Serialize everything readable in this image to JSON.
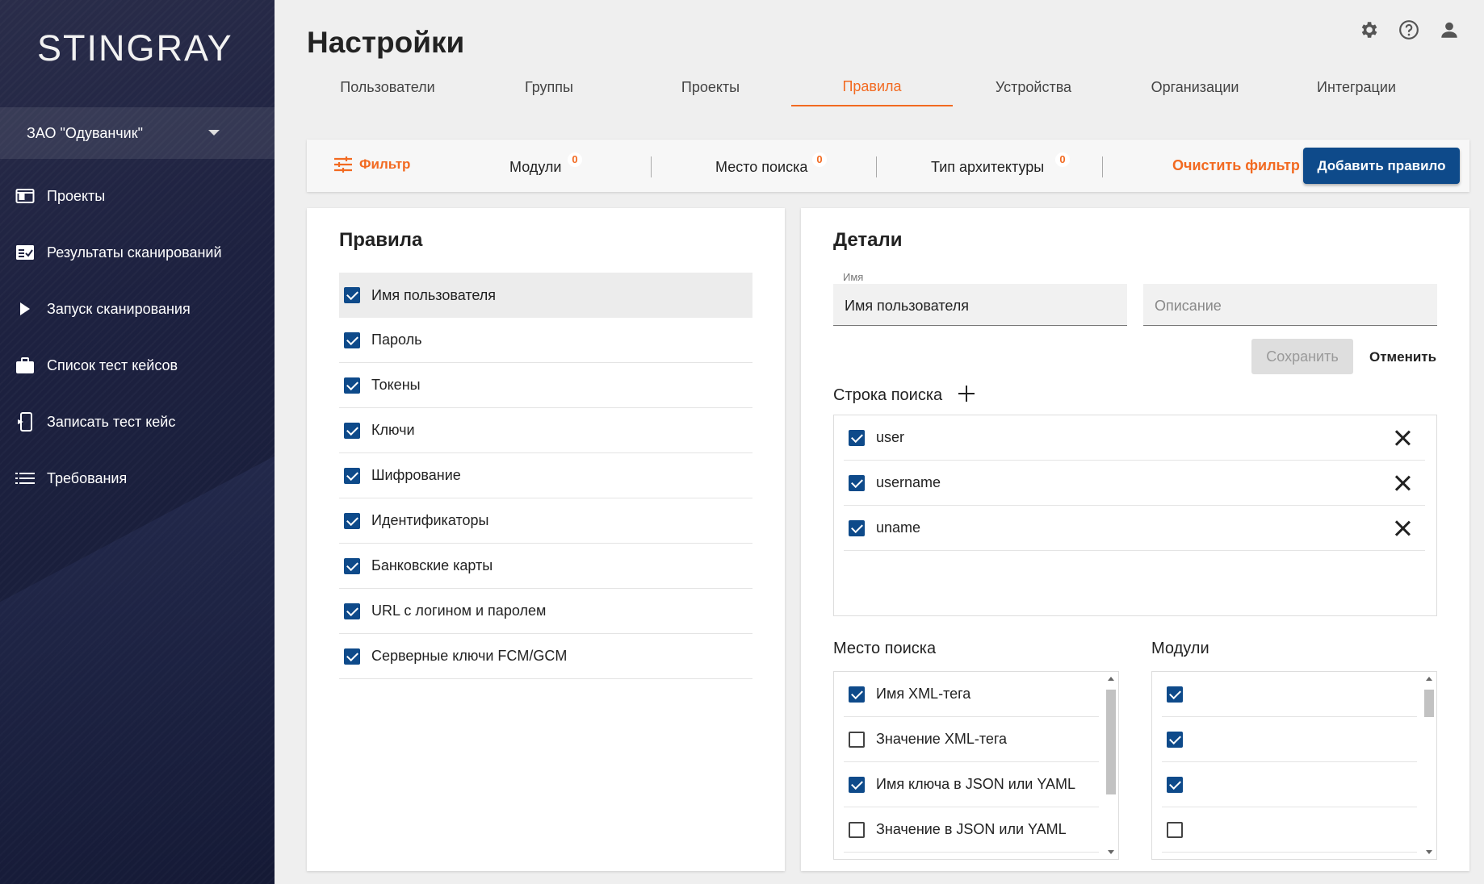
{
  "sidebar": {
    "logo": "STINGRAY",
    "org": "ЗАО \"Одуванчик\"",
    "items": [
      {
        "label": "Проекты",
        "icon": "projects-icon"
      },
      {
        "label": "Результаты сканирований",
        "icon": "scan-results-icon"
      },
      {
        "label": "Запуск сканирования",
        "icon": "play-icon"
      },
      {
        "label": "Список тест кейсов",
        "icon": "briefcase-icon"
      },
      {
        "label": "Записать тест кейс",
        "icon": "record-device-icon"
      },
      {
        "label": "Требования",
        "icon": "list-icon"
      }
    ]
  },
  "header": {
    "title": "Настройки",
    "icons": [
      "gear-icon",
      "help-icon",
      "user-icon"
    ]
  },
  "tabs": [
    {
      "label": "Пользователи"
    },
    {
      "label": "Группы"
    },
    {
      "label": "Проекты"
    },
    {
      "label": "Правила",
      "active": true
    },
    {
      "label": "Устройства"
    },
    {
      "label": "Организации"
    },
    {
      "label": "Интеграции"
    }
  ],
  "filter": {
    "label": "Фильтр",
    "modules": {
      "label": "Модули",
      "count": "0"
    },
    "place": {
      "label": "Место поиска",
      "count": "0"
    },
    "arch": {
      "label": "Тип архитектуры",
      "count": "0"
    },
    "clear": "Очистить фильтр",
    "add": "Добавить правило"
  },
  "rules_panel": {
    "title": "Правила",
    "items": [
      {
        "label": "Имя пользователя",
        "checked": true,
        "selected": true
      },
      {
        "label": "Пароль",
        "checked": true
      },
      {
        "label": "Токены",
        "checked": true
      },
      {
        "label": "Ключи",
        "checked": true
      },
      {
        "label": "Шифрование",
        "checked": true
      },
      {
        "label": "Идентификаторы",
        "checked": true
      },
      {
        "label": "Банковские карты",
        "checked": true
      },
      {
        "label": "URL с логином и паролем",
        "checked": true
      },
      {
        "label": "Серверные ключи FCM/GCM",
        "checked": true
      }
    ]
  },
  "details": {
    "title": "Детали",
    "name_label": "Имя",
    "name_value": "Имя пользователя",
    "description_placeholder": "Описание",
    "save": "Сохранить",
    "cancel": "Отменить",
    "search_string_label": "Строка поиска",
    "search_strings": [
      {
        "value": "user",
        "checked": true
      },
      {
        "value": "username",
        "checked": true
      },
      {
        "value": "uname",
        "checked": true
      }
    ],
    "place_label": "Место поиска",
    "places": [
      {
        "label": "Имя XML-тега",
        "checked": true
      },
      {
        "label": "Значение XML-тега",
        "checked": false
      },
      {
        "label": "Имя ключа в JSON или YAML",
        "checked": true
      },
      {
        "label": "Значение в JSON или YAML",
        "checked": false
      }
    ],
    "modules_label": "Модули",
    "modules": [
      {
        "checked": true
      },
      {
        "checked": true
      },
      {
        "checked": true
      },
      {
        "checked": false
      }
    ]
  }
}
